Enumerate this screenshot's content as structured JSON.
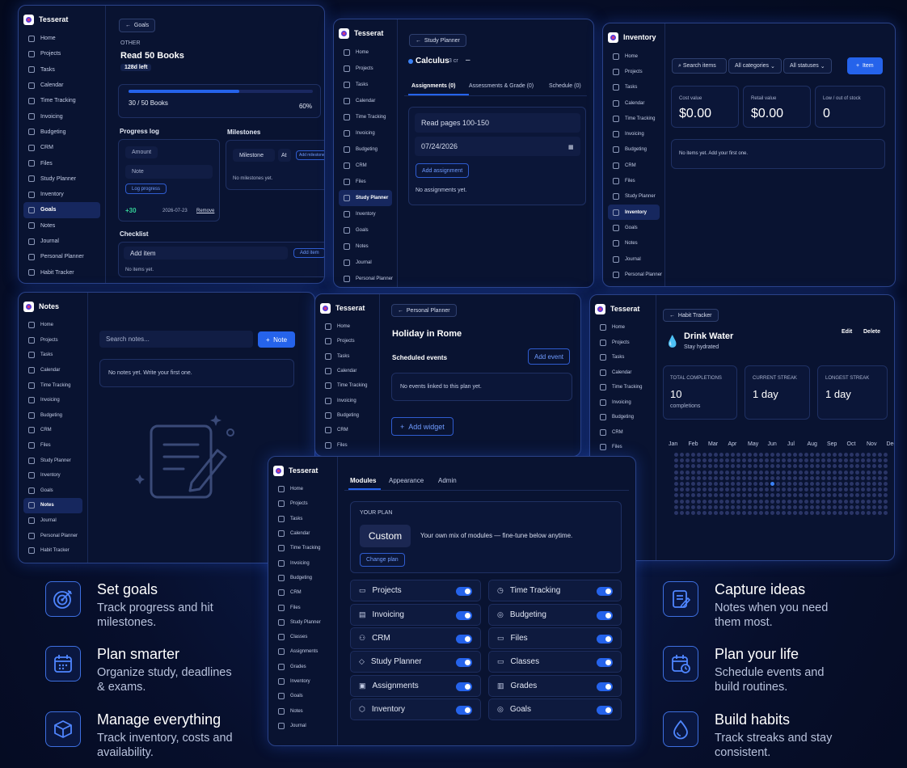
{
  "brand": "Tesserat",
  "nav": {
    "home": "Home",
    "projects": "Projects",
    "tasks": "Tasks",
    "calendar": "Calendar",
    "time_tracking": "Time Tracking",
    "invoicing": "Invoicing",
    "budgeting": "Budgeting",
    "crm": "CRM",
    "files": "Files",
    "study_planner": "Study Planner",
    "inventory": "Inventory",
    "goals": "Goals",
    "notes": "Notes",
    "journal": "Journal",
    "personal_planner": "Personal Planner",
    "habit_tracker": "Habit Tracker",
    "classes": "Classes",
    "assignments": "Assignments",
    "grades": "Grades"
  },
  "goals": {
    "back": "Goals",
    "category": "OTHER",
    "title": "Read 50 Books",
    "days_left": "128d left",
    "progress_text": "30 / 50 Books",
    "progress_pct": "60%",
    "progress_value": 0.6,
    "log_title": "Progress log",
    "amount_ph": "Amount",
    "note_ph": "Note",
    "log_btn": "Log progress",
    "log_val": "+30",
    "log_date": "2026-07-23",
    "log_remove": "Remove",
    "milestones_title": "Milestones",
    "milestone_ph": "Milestone",
    "at_ph": "At",
    "add_milestone": "Add milestone",
    "no_milestones": "No milestones yet.",
    "checklist_title": "Checklist",
    "add_item_ph": "Add item",
    "add_item_btn": "Add item",
    "no_items": "No items yet."
  },
  "study": {
    "back": "Study Planner",
    "course": "Calculus",
    "credits": "3 cr",
    "tabs": [
      "Assignments (0)",
      "Assessments & Grade (0)",
      "Schedule (0)"
    ],
    "title_value": "Read pages 100-150",
    "date_value": "07/24/2026",
    "add_btn": "Add assignment",
    "empty": "No assignments yet."
  },
  "inventory": {
    "title": "Inventory",
    "search_ph": "Search items",
    "cat_select": "All categories",
    "status_select": "All statuses",
    "add_btn": "Item",
    "stats": [
      {
        "label": "Cost value",
        "value": "$0.00"
      },
      {
        "label": "Retail value",
        "value": "$0.00"
      },
      {
        "label": "Low / out of stock",
        "value": "0"
      }
    ],
    "empty": "No items yet. Add your first one."
  },
  "notes": {
    "title": "Notes",
    "search_ph": "Search notes...",
    "add_btn": "Note",
    "empty": "No notes yet. Write your first one."
  },
  "planner": {
    "back": "Personal Planner",
    "title": "Holiday in Rome",
    "events_title": "Scheduled events",
    "add_event": "Add event",
    "empty": "No events linked to this plan yet.",
    "add_widget": "Add widget"
  },
  "habit": {
    "back": "Habit Tracker",
    "title": "Drink Water",
    "subtitle": "Stay hydrated",
    "edit": "Edit",
    "delete": "Delete",
    "stats": [
      {
        "label": "TOTAL COMPLETIONS",
        "value": "10",
        "sub": "completions"
      },
      {
        "label": "CURRENT STREAK",
        "value": "1 day",
        "sub": ""
      },
      {
        "label": "LONGEST STREAK",
        "value": "1 day",
        "sub": ""
      }
    ],
    "months": [
      "Jan",
      "Feb",
      "Mar",
      "Apr",
      "May",
      "Jun",
      "Jul",
      "Aug",
      "Sep",
      "Oct",
      "Nov",
      "Dec"
    ]
  },
  "settings": {
    "tabs": [
      "Modules",
      "Appearance",
      "Admin"
    ],
    "plan_label": "YOUR PLAN",
    "plan_name": "Custom",
    "plan_desc": "Your own mix of modules — fine-tune below anytime.",
    "change_plan": "Change plan",
    "modules": [
      "Projects",
      "Time Tracking",
      "Invoicing",
      "Budgeting",
      "CRM",
      "Files",
      "Study Planner",
      "Classes",
      "Assignments",
      "Grades",
      "Inventory",
      "Goals"
    ]
  },
  "features": [
    {
      "title": "Set goals",
      "desc": "Track progress and hit milestones.",
      "icon": "target-icon"
    },
    {
      "title": "Plan smarter",
      "desc": "Organize study, deadlines & exams.",
      "icon": "calendar-icon"
    },
    {
      "title": "Manage everything",
      "desc": "Track inventory, costs and availability.",
      "icon": "box-icon"
    },
    {
      "title": "Capture ideas",
      "desc": "Notes when you need them most.",
      "icon": "note-icon"
    },
    {
      "title": "Plan your life",
      "desc": "Schedule events and build routines.",
      "icon": "calendar-clock-icon"
    },
    {
      "title": "Build habits",
      "desc": "Track streaks and stay consistent.",
      "icon": "drop-icon"
    }
  ],
  "colors": {
    "accent": "#2563eb",
    "bg": "#070f2c"
  }
}
